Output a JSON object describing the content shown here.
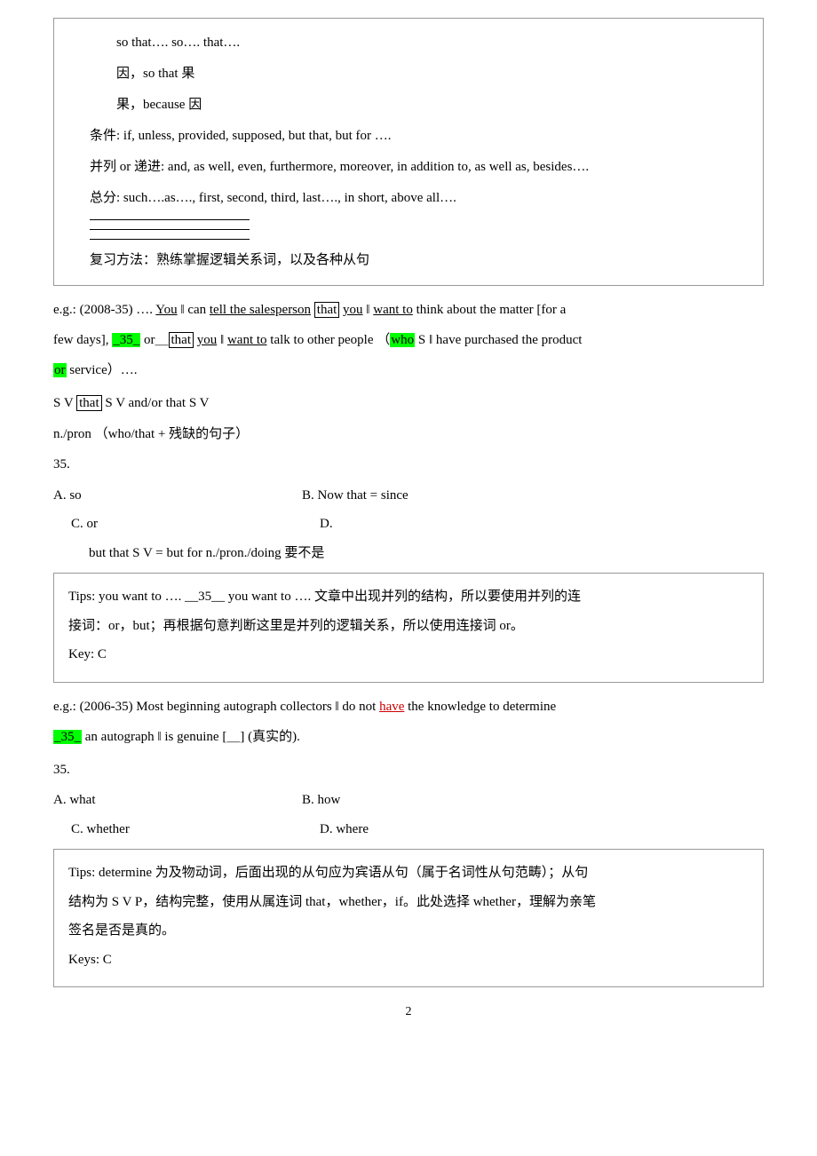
{
  "page": {
    "number": "2"
  },
  "box1": {
    "lines": [
      {
        "text": "so that….   so….  that…."
      },
      {
        "text": "因，so that  果",
        "indent": true
      },
      {
        "text": "果，because  因",
        "indent": true
      },
      {
        "text": "条件: if, unless, provided, supposed, but that, but for …."
      },
      {
        "text": "并列 or 递进: and, as well, even, furthermore, moreover, in addition to, as well as, besides…."
      },
      {
        "text": "总分: such….as…., first, second, third, last…., in short, above all…."
      }
    ],
    "review_method": "复习方法：熟练掌握逻辑关系词，以及各种从句"
  },
  "eg1": {
    "label": "e.g.: (2008-35)",
    "text1": "…. You ‖ can tell the salesperson",
    "that1": "that",
    "text2": "you ‖ want to think about the matter [for a few days],",
    "blank35": "35",
    "or_text": "or",
    "that2": "that",
    "text3": "you ‖ want to talk to other people  （",
    "who_text": "who",
    "text4": "S ‖ have purchased the product or service）….  "
  },
  "sv_line": "S V that S V and/or that S V",
  "npron_line": "n./pron  （who/that + 残缺的句子）",
  "q35": {
    "number": "35.",
    "optA": "A. so",
    "optB": "B. Now that = since",
    "optC": "C. or",
    "optD": "D.",
    "but_that_line": "but that S V = but for n./pron./doing  要不是"
  },
  "tips1": {
    "text1": "Tips: you want to ….  __35__  you want to ….  文章中出现并列的结构，所以要使用并列的连",
    "text2": "接词：or，but；再根据句意判断这里是并列的逻辑关系，所以使用连接词 or。",
    "key": "Key: C"
  },
  "eg2": {
    "label": "e.g.: (2006-35)",
    "text1": "Most beginning autograph collectors ‖ do not",
    "have_text": "have",
    "text2": "the knowledge to determine",
    "blank35": "35",
    "text3": "an autograph ‖ is genuine [＿] (真实的)."
  },
  "q35b": {
    "number": "35.",
    "optA": "A. what",
    "optB": "B. how",
    "optC": "C. whether",
    "optD": "D. where"
  },
  "tips2": {
    "text1": "Tips: determine  为及物动词，后面出现的从句应为宾语从句（属于名词性从句范畴）；从句",
    "text2": "结构为 S V P，结构完整，使用从属连词  that，whether，if。此处选择 whether，理解为亲笔",
    "text3": "签名是否是真的。",
    "key": "Keys: C"
  }
}
